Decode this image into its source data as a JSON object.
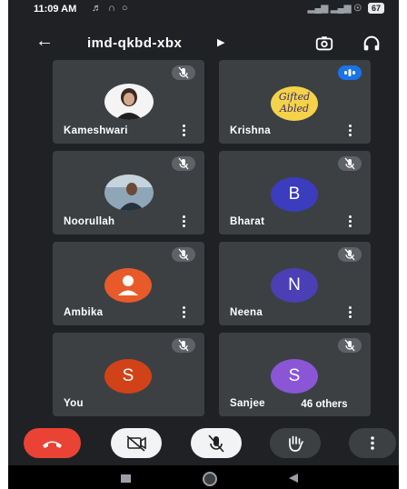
{
  "status_bar": {
    "time": "11:09 AM",
    "battery": "67"
  },
  "header": {
    "meeting_code": "imd-qkbd-xbx"
  },
  "participants": [
    {
      "name": "Kameshwari"
    },
    {
      "name": "Krishna",
      "logo_text": "Gifted Abled"
    },
    {
      "name": "Noorullah"
    },
    {
      "name": "Bharat",
      "initial": "B",
      "color": "#3c3cbf"
    },
    {
      "name": "Ambika",
      "color": "#e85a2a"
    },
    {
      "name": "Neena",
      "initial": "N",
      "color": "#4a3fb5"
    },
    {
      "name": "You",
      "initial": "S",
      "color": "#d24219"
    },
    {
      "name": "Sanjee",
      "initial": "S",
      "color": "#8a56d6"
    }
  ],
  "others_chip": "46 others",
  "controls": {
    "end_call_color": "#ea4335",
    "video_off_bg": "#f1f3f4",
    "mic_off_bg": "#f1f3f4",
    "raise_hand_bg": "#3c4043",
    "more_bg": "#3c4043"
  }
}
